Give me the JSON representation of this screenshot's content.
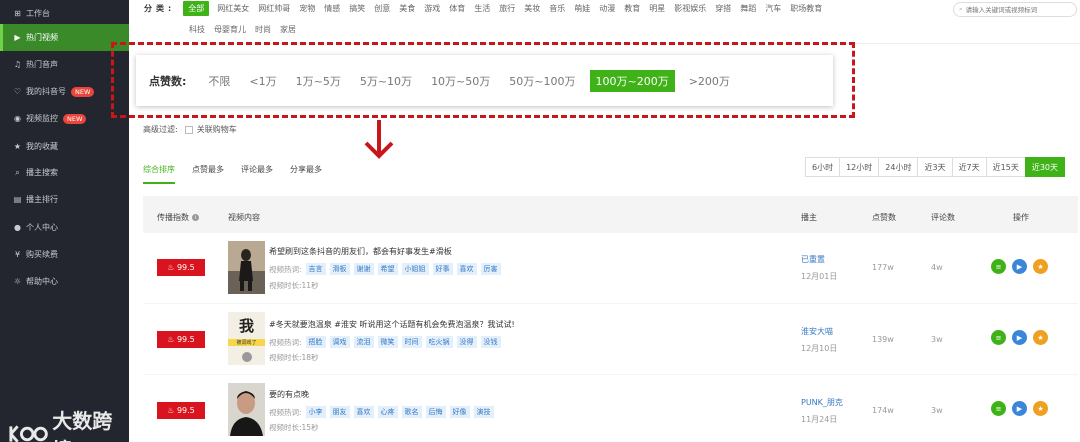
{
  "sidebar": {
    "items": [
      {
        "label": "工作台",
        "icon": "dashboard-icon",
        "glyph": "⊞"
      },
      {
        "label": "热门视频",
        "icon": "video-icon",
        "glyph": "▶"
      },
      {
        "label": "热门音声",
        "icon": "music-icon",
        "glyph": "♫"
      },
      {
        "label": "我的抖音号",
        "icon": "account-icon",
        "glyph": "♡",
        "badge": "NEW"
      },
      {
        "label": "视频监控",
        "icon": "monitor-icon",
        "glyph": "◉",
        "badge": "NEW"
      },
      {
        "label": "我的收藏",
        "icon": "star-icon",
        "glyph": "★"
      },
      {
        "label": "播主搜索",
        "icon": "search-icon",
        "glyph": "⌕"
      },
      {
        "label": "播主排行",
        "icon": "ranking-icon",
        "glyph": "▤"
      },
      {
        "label": "个人中心",
        "icon": "user-icon",
        "glyph": "●"
      },
      {
        "label": "购买续费",
        "icon": "purchase-icon",
        "glyph": "¥"
      },
      {
        "label": "帮助中心",
        "icon": "help-icon",
        "glyph": "☼"
      }
    ],
    "watermark": "大数跨境"
  },
  "categories": {
    "label": "分类:",
    "row1": [
      "全部",
      "网红美女",
      "网红帅哥",
      "宠物",
      "情感",
      "搞笑",
      "创意",
      "美食",
      "游戏",
      "体育",
      "生活",
      "旅行",
      "美妆",
      "音乐",
      "萌娃",
      "动漫",
      "教育",
      "明星",
      "影视娱乐",
      "穿搭",
      "舞蹈",
      "汽车",
      "职场教育"
    ],
    "row2": [
      "科技",
      "母婴育儿",
      "时尚",
      "家居"
    ],
    "active": "全部"
  },
  "search": {
    "placeholder": "请输入关键词或视频标词"
  },
  "likes_filter": {
    "label": "点赞数:",
    "options": [
      "不限",
      "<1万",
      "1万~5万",
      "5万~10万",
      "10万~50万",
      "50万~100万",
      "100万~200万",
      ">200万"
    ],
    "active": "100万~200万"
  },
  "advanced": {
    "label": "高级过滤:",
    "checkbox_label": "关联购物车"
  },
  "sort_tabs": {
    "items": [
      "综合排序",
      "点赞最多",
      "评论最多",
      "分享最多"
    ],
    "active": "综合排序"
  },
  "time_tabs": {
    "items": [
      "6小时",
      "12小时",
      "24小时",
      "近3天",
      "近7天",
      "近15天",
      "近30天"
    ],
    "active": "近30天"
  },
  "table": {
    "headers": {
      "score": "传播指数",
      "content": "视频内容",
      "author": "播主",
      "likes": "点赞数",
      "comments": "评论数",
      "actions": "操作"
    },
    "tag_label": "视频热词:",
    "duration_label": "视频时长:",
    "rows": [
      {
        "score": "99.5",
        "title": "希望刷到这条抖音的朋友们，都会有好事发生#滑板",
        "tags": [
          "吉言",
          "滑板",
          "谢谢",
          "希望",
          "小姐姐",
          "好事",
          "喜欢",
          "厉害"
        ],
        "duration": "11秒",
        "author": "已重置",
        "date": "12月01日",
        "likes": "177w",
        "comments": "4w"
      },
      {
        "score": "99.5",
        "title": "#冬天就要泡温泉 #淮安 听说用这个话题有机会免费泡温泉？我试试!",
        "tags": [
          "捂脸",
          "调戏",
          "流泪",
          "微笑",
          "时间",
          "吃火锅",
          "没得",
          "没钱"
        ],
        "duration": "18秒",
        "author": "淮安大喵",
        "date": "12月10日",
        "likes": "139w",
        "comments": "3w",
        "thumb_text": "我",
        "thumb_sub": "被调戏了"
      },
      {
        "score": "99.5",
        "title": "要的有点晚",
        "tags": [
          "小李",
          "朋友",
          "喜欢",
          "心疼",
          "歌名",
          "后悔",
          "好像",
          "演技"
        ],
        "duration": "15秒",
        "author": "PUNK_朋克",
        "date": "11月24日",
        "likes": "174w",
        "comments": "3w"
      }
    ]
  },
  "colors": {
    "accent": "#3fb218",
    "sidebar": "#23262e",
    "highlight": "#c8171b",
    "score": "#d9141e"
  }
}
